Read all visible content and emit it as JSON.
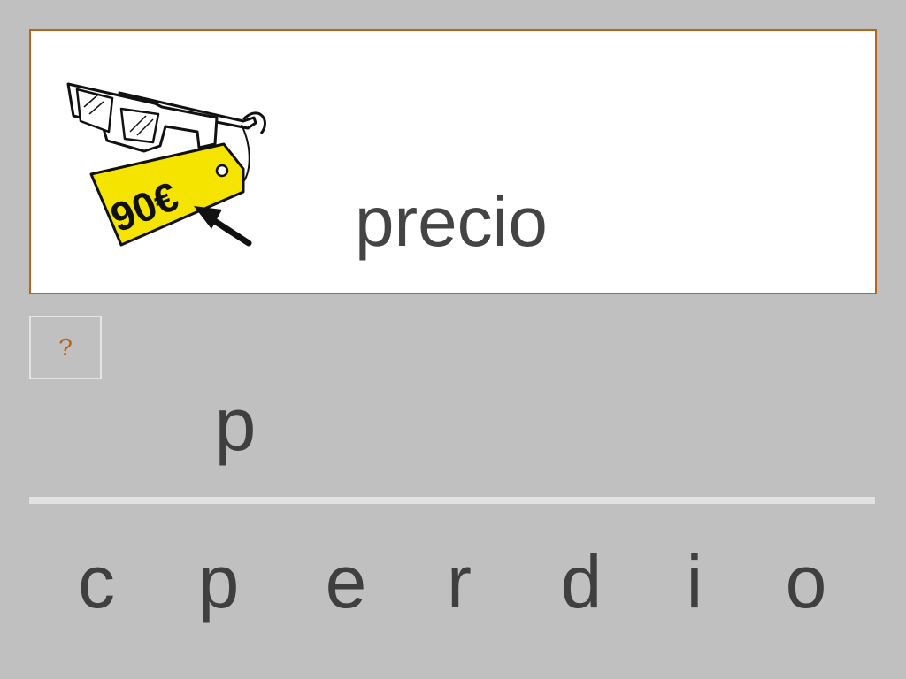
{
  "exercise": {
    "word": "precio",
    "price_tag_text": "90€",
    "hint_label": "?",
    "answer_letters": [
      "p"
    ],
    "letter_choices": [
      "c",
      "p",
      "e",
      "r",
      "d",
      "i",
      "o"
    ]
  },
  "colors": {
    "background": "#c0c0c0",
    "card_border": "#b5651d",
    "tag_yellow": "#f5e400",
    "text": "#444444"
  },
  "icons": [
    "glasses-icon",
    "price-tag-icon",
    "arrow-icon"
  ]
}
